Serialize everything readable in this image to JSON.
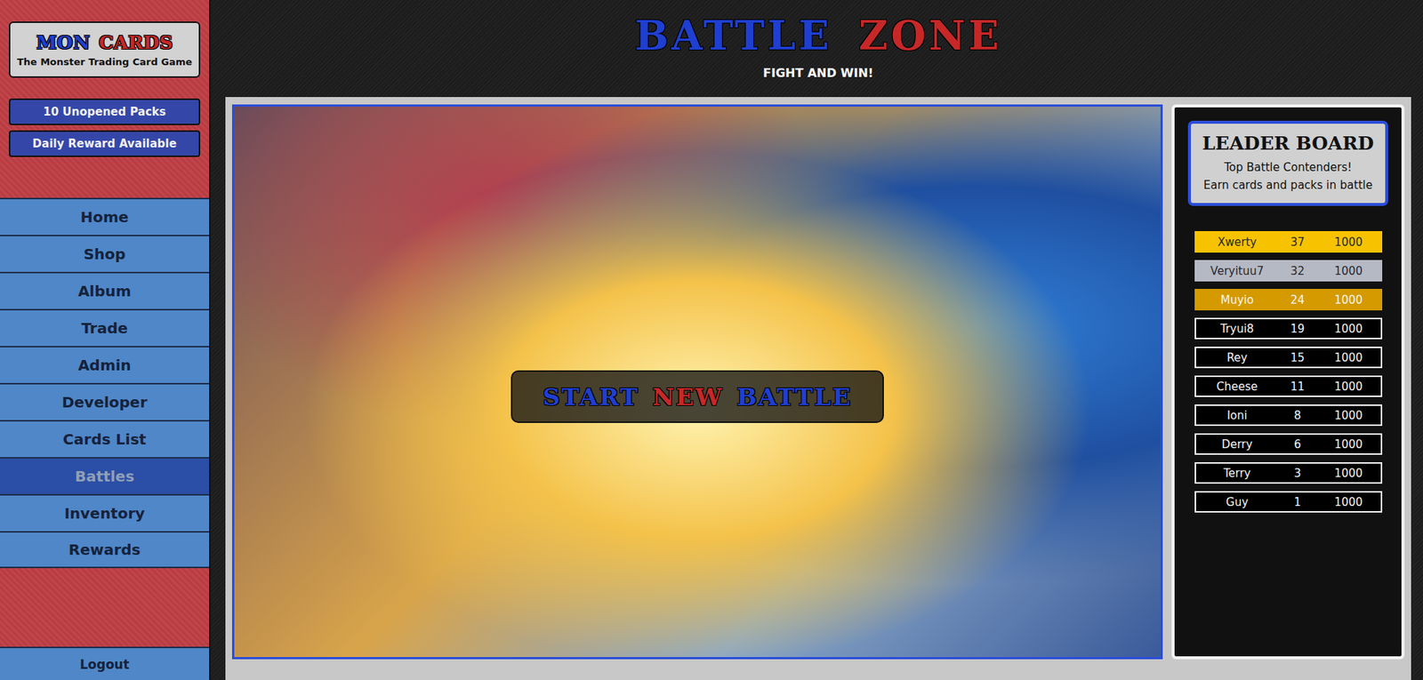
{
  "logo": {
    "words": [
      {
        "text": "MON",
        "color": "#1f3fd1"
      },
      {
        "text": "CARDS",
        "color": "#c62828"
      }
    ],
    "tagline": "The Monster Trading Card Game"
  },
  "status_buttons": [
    "10 Unopened Packs",
    "Daily Reward Available"
  ],
  "sidebar": {
    "items": [
      {
        "label": "Home",
        "selected": false
      },
      {
        "label": "Shop",
        "selected": false
      },
      {
        "label": "Album",
        "selected": false
      },
      {
        "label": "Trade",
        "selected": false
      },
      {
        "label": "Admin",
        "selected": false
      },
      {
        "label": "Developer",
        "selected": false
      },
      {
        "label": "Cards List",
        "selected": false
      },
      {
        "label": "Battles",
        "selected": true
      },
      {
        "label": "Inventory",
        "selected": false
      },
      {
        "label": "Rewards",
        "selected": false
      }
    ],
    "logout": "Logout"
  },
  "header": {
    "title": [
      {
        "text": "BATTLE",
        "color": "#1f3fd1"
      },
      {
        "text": "ZONE",
        "color": "#c62828"
      }
    ],
    "subtitle": "FIGHT AND WIN!"
  },
  "battle": {
    "button": [
      {
        "text": "START",
        "color": "#1f3fd1"
      },
      {
        "text": "NEW",
        "color": "#c62828"
      },
      {
        "text": "BATTLE",
        "color": "#1f3fd1"
      }
    ]
  },
  "leaderboard": {
    "title": "LEADER BOARD",
    "lines": [
      "Top Battle Contenders!",
      "Earn cards and packs in battle"
    ],
    "rows": [
      {
        "name": "Xwerty",
        "wins": "37",
        "score": "1000",
        "color": "#f7c300"
      },
      {
        "name": "Veryituu7",
        "wins": "32",
        "score": "1000",
        "color": "#b5b9c4"
      },
      {
        "name": "Muyio",
        "wins": "24",
        "score": "1000",
        "color": "#d49a00"
      },
      {
        "name": "Tryui8",
        "wins": "19",
        "score": "1000",
        "color": "#000000"
      },
      {
        "name": "Rey",
        "wins": "15",
        "score": "1000",
        "color": "#000000"
      },
      {
        "name": "Cheese",
        "wins": "11",
        "score": "1000",
        "color": "#000000"
      },
      {
        "name": "Ioni",
        "wins": "8",
        "score": "1000",
        "color": "#000000"
      },
      {
        "name": "Derry",
        "wins": "6",
        "score": "1000",
        "color": "#000000"
      },
      {
        "name": "Terry",
        "wins": "3",
        "score": "1000",
        "color": "#000000"
      },
      {
        "name": "Guy",
        "wins": "1",
        "score": "1000",
        "color": "#000000"
      }
    ]
  }
}
